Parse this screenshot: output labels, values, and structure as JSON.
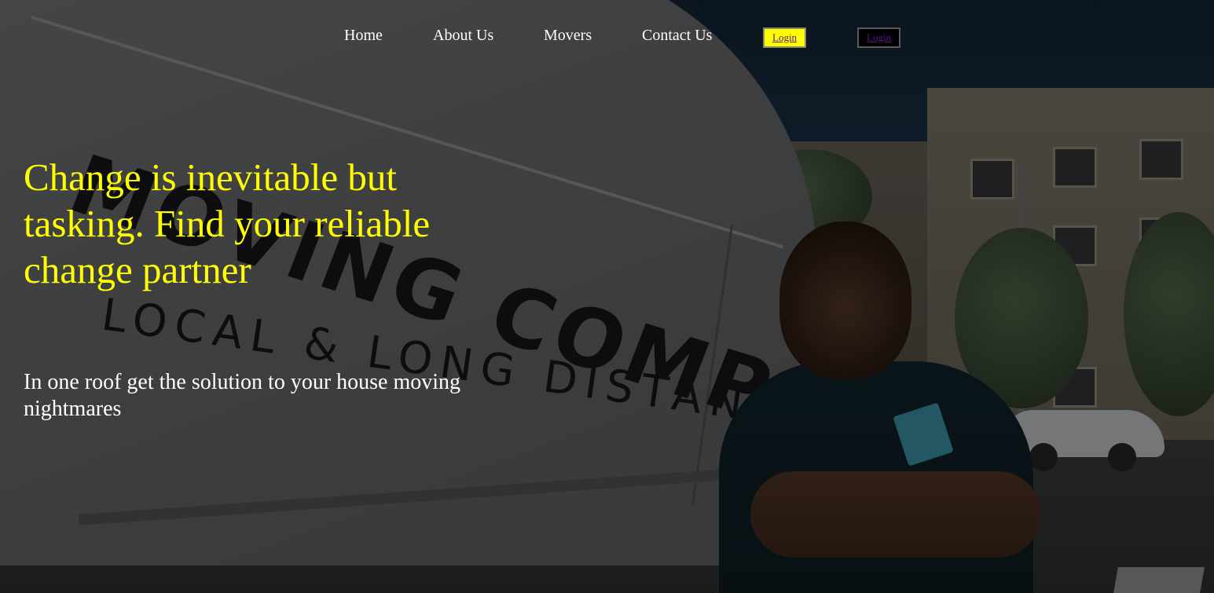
{
  "nav": {
    "links": [
      "Home",
      "About Us",
      "Movers",
      "Contact Us"
    ],
    "login_primary": "Login",
    "login_secondary": "Login"
  },
  "hero": {
    "headline": "Change is inevitable but tasking. Find your reliable change partner",
    "subline": "In one roof get the solution to your house moving nightmares",
    "background_photo_text": {
      "line1": "MOVING COMPANY",
      "line2": "LOCAL & LONG DISTANCE"
    }
  },
  "colors": {
    "headline": "#ffff00",
    "nav_text": "#ffffff",
    "login_primary_bg": "#ffff00",
    "login_secondary_bg": "#000000",
    "login_text": "#551a8b"
  }
}
